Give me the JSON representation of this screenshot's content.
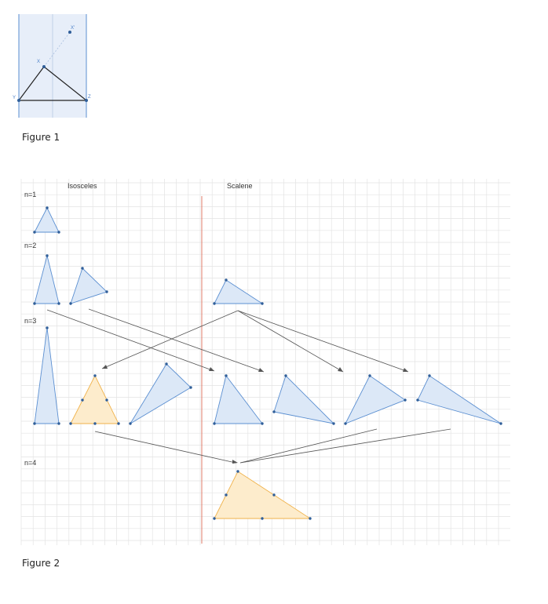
{
  "figure1": {
    "caption": "Figure 1",
    "labels": {
      "x": "X",
      "x_prime": "X'",
      "y": "Y",
      "z": "Z"
    }
  },
  "figure2": {
    "caption": "Figure 2",
    "columns": {
      "isosceles": "Isosceles",
      "scalene": "Scalene"
    },
    "rows": {
      "n1": "n=1",
      "n2": "n=2",
      "n3": "n=3",
      "n4": "n=4"
    }
  },
  "colors": {
    "blue_fill": "#dce8f7",
    "blue_stroke": "#5b8fd1",
    "orange_fill": "#fdeccc",
    "orange_stroke": "#f0b24a",
    "divider": "#e07b6a",
    "grid": "#e3e3e3",
    "arrow": "#555555",
    "vertex": "#2f5e99"
  }
}
